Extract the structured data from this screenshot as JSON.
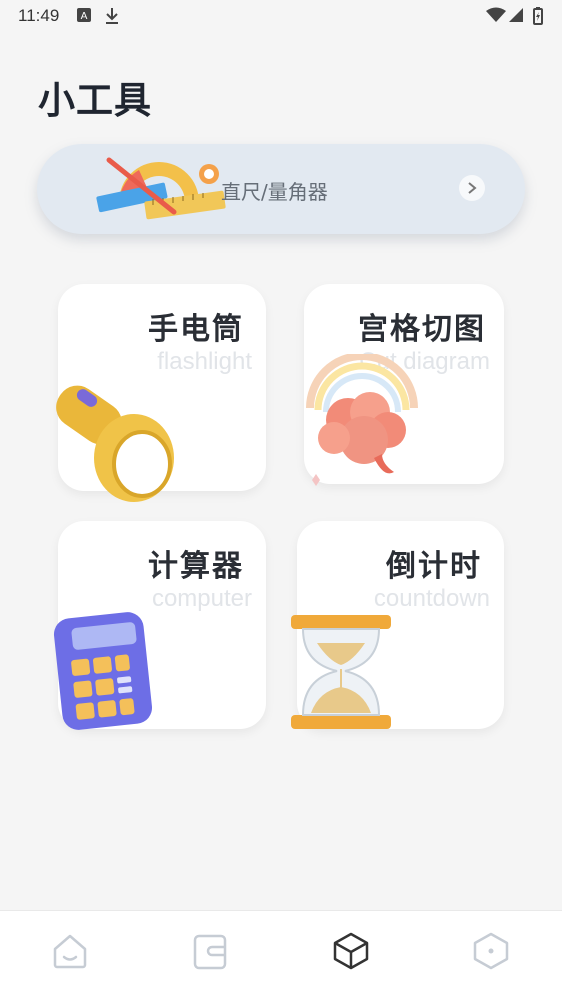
{
  "status_bar": {
    "time": "11:49"
  },
  "page": {
    "title": "小工具"
  },
  "ruler_card": {
    "label": "直尺/量角器"
  },
  "tools": [
    {
      "title": "手电筒",
      "subtitle": "flashlight"
    },
    {
      "title": "宫格切图",
      "subtitle": "Cut diagram"
    },
    {
      "title": "计算器",
      "subtitle": "computer"
    },
    {
      "title": "倒计时",
      "subtitle": "countdown"
    }
  ],
  "tabbar": {
    "tabs": [
      {
        "icon": "home-icon"
      },
      {
        "icon": "wallet-icon"
      },
      {
        "icon": "cube-icon",
        "active": true
      },
      {
        "icon": "hexagon-icon"
      }
    ]
  },
  "colors": {
    "active_tab": "#333333",
    "inactive_tab": "#c6ccd4",
    "ruler_card_bg": "#e2e9f1"
  }
}
